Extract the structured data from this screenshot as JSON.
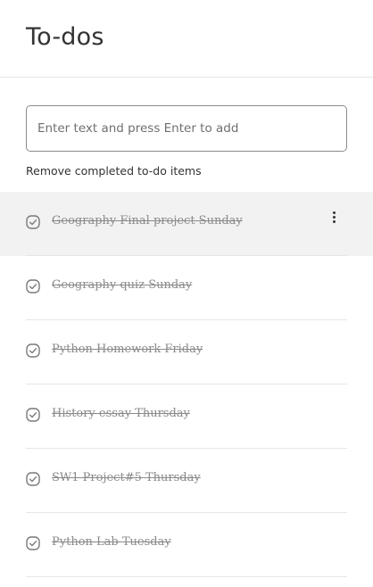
{
  "header": {
    "title": "To-dos"
  },
  "add_input": {
    "placeholder": "Enter text and press Enter to add",
    "value": ""
  },
  "remove_completed_label": "Remove completed to-do items",
  "todos": [
    {
      "label": "Geography Final project Sunday",
      "completed": true
    },
    {
      "label": "Geography quiz Sunday",
      "completed": true
    },
    {
      "label": "Python Homework Friday",
      "completed": true
    },
    {
      "label": "History essay Thursday",
      "completed": true
    },
    {
      "label": "SW1 Project#5 Thursday",
      "completed": true
    },
    {
      "label": "Python Lab Tuesday",
      "completed": true
    }
  ],
  "icons": {
    "check": "check-circle-icon",
    "more": "more-vertical-icon"
  },
  "colors": {
    "completed_text": "#8a8a8a",
    "hover_row": "#f2f2f2"
  }
}
